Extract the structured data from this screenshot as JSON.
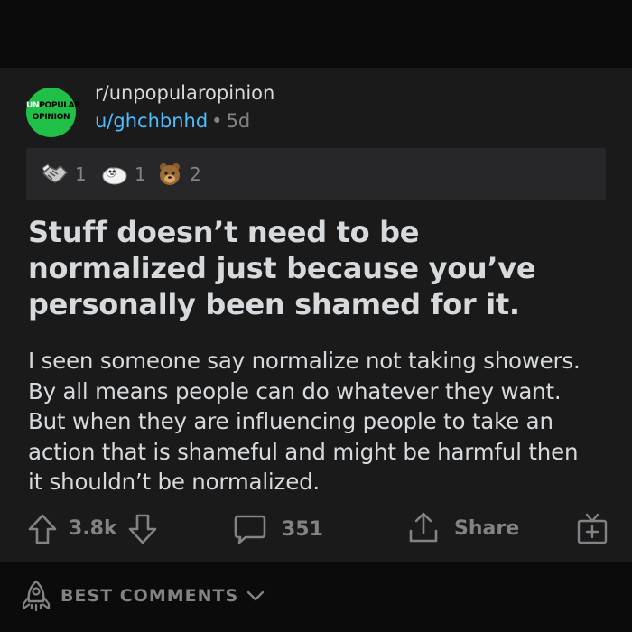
{
  "subreddit": {
    "name": "r/unpopularopinion",
    "icon_text_line1": "UNPOPULAR",
    "icon_text_line2": "OPINION",
    "icon_color": "#1fbf48"
  },
  "post": {
    "author": "u/ghchbnhd",
    "separator": "•",
    "age": "5d",
    "awards": [
      {
        "icon": "handshake-award-icon",
        "count": "1"
      },
      {
        "icon": "wholesome-seal-award-icon",
        "count": "1"
      },
      {
        "icon": "bear-award-icon",
        "count": "2"
      }
    ],
    "title": "Stuff doesn’t need to be normalized just because you’ve personally been shamed for it.",
    "body_lines": [
      "I seen someone say normalize not taking showers.",
      "By all means people can do whatever they want.",
      "But when they are influencing people to take an",
      "action that is shameful and might be harmful then",
      "it shouldn’t be normalized."
    ],
    "score": "3.8k",
    "comments_count": "351",
    "share_label": "Share"
  },
  "comments": {
    "sort_label": "BEST COMMENTS"
  },
  "colors": {
    "background": "#0b0b0b",
    "card": "#1a1a1b",
    "awards_bar": "#272729",
    "text": "#d7dadc",
    "muted": "#818384",
    "link": "#4fbcff"
  }
}
